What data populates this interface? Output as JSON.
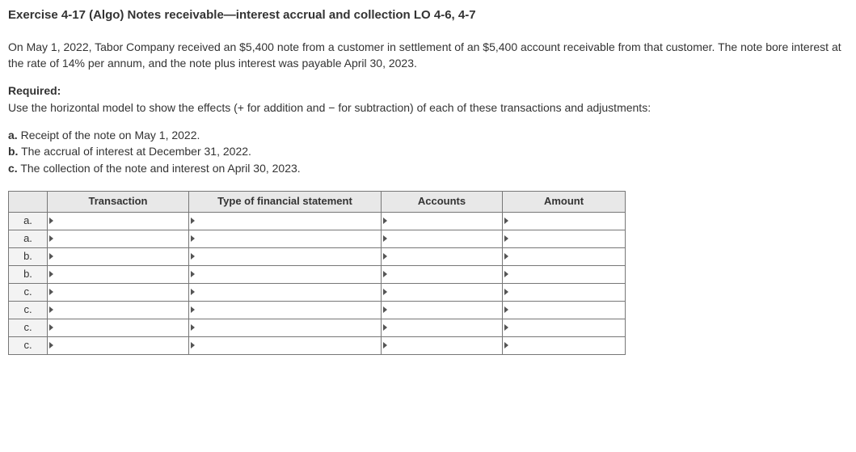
{
  "title": "Exercise 4-17 (Algo) Notes receivable—interest accrual and collection LO 4-6, 4-7",
  "intro": "On May 1, 2022, Tabor Company received an $5,400 note from a customer in settlement of an $5,400 account receivable from that customer. The note bore interest at the rate of 14% per annum, and the note plus interest was payable April 30, 2023.",
  "required_label": "Required:",
  "required_text": "Use the horizontal model to show the effects (+ for addition and − for subtraction) of each of these transactions and adjustments:",
  "items": {
    "a_label": "a.",
    "a_text": " Receipt of the note on May 1, 2022.",
    "b_label": "b.",
    "b_text": " The accrual of interest at December 31, 2022.",
    "c_label": "c.",
    "c_text": " The collection of the note and interest on April 30, 2023."
  },
  "table": {
    "headers": {
      "blank": "",
      "transaction": "Transaction",
      "type": "Type of financial statement",
      "accounts": "Accounts",
      "amount": "Amount"
    },
    "rows": [
      {
        "label": "a.",
        "transaction": "",
        "type": "",
        "accounts": "",
        "amount": ""
      },
      {
        "label": "a.",
        "transaction": "",
        "type": "",
        "accounts": "",
        "amount": ""
      },
      {
        "label": "b.",
        "transaction": "",
        "type": "",
        "accounts": "",
        "amount": ""
      },
      {
        "label": "b.",
        "transaction": "",
        "type": "",
        "accounts": "",
        "amount": ""
      },
      {
        "label": "c.",
        "transaction": "",
        "type": "",
        "accounts": "",
        "amount": ""
      },
      {
        "label": "c.",
        "transaction": "",
        "type": "",
        "accounts": "",
        "amount": ""
      },
      {
        "label": "c.",
        "transaction": "",
        "type": "",
        "accounts": "",
        "amount": ""
      },
      {
        "label": "c.",
        "transaction": "",
        "type": "",
        "accounts": "",
        "amount": ""
      }
    ]
  }
}
